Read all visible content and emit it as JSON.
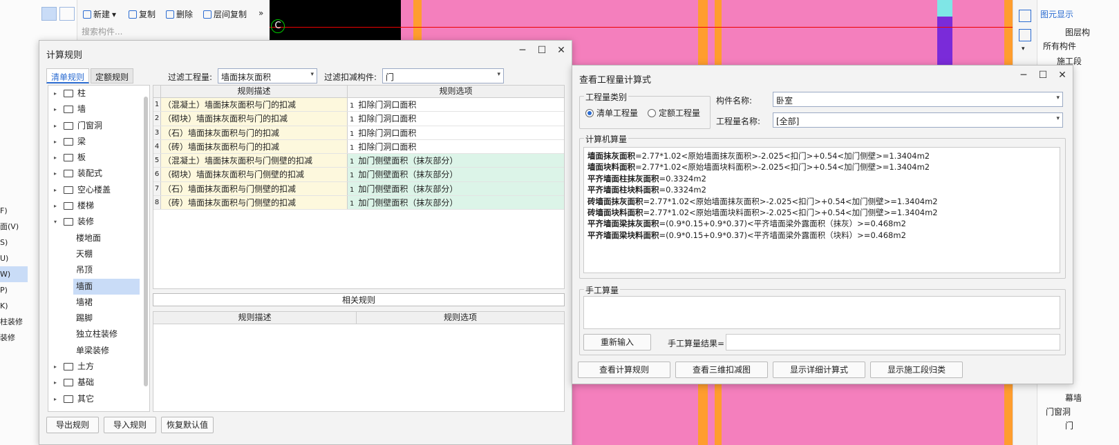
{
  "background": {
    "toolbar": {
      "new": "新建",
      "copy": "复制",
      "delete": "删除",
      "floor_copy": "层间复制"
    },
    "search_placeholder": "搜索构件...",
    "left_list": [
      "F)",
      "面(V)",
      "S)",
      "U)",
      "W)",
      "P)",
      "K)",
      "柱装修",
      "装修"
    ],
    "left_list_selected": 4,
    "right_panel": {
      "tab": "图元显示",
      "layers": "图层构",
      "all": "所有构件",
      "section": "施工段",
      "curtain": "幕墙",
      "door_window": "门窗洞",
      "door": "门"
    },
    "canvas_colors": {
      "pink": "#f47fbd",
      "orange": "#ff9d2e",
      "black": "#000000"
    }
  },
  "dialog1": {
    "title": "计算规则",
    "tabs": [
      "清单规则",
      "定额规则"
    ],
    "filter_qty_label": "过滤工程量:",
    "filter_qty_value": "墙面抹灰面积",
    "filter_deduct_label": "过滤扣减构件:",
    "filter_deduct_value": "门",
    "tree": [
      {
        "label": "柱",
        "level": 0,
        "expanded": false
      },
      {
        "label": "墙",
        "level": 0,
        "expanded": false
      },
      {
        "label": "门窗洞",
        "level": 0,
        "expanded": false
      },
      {
        "label": "梁",
        "level": 0,
        "expanded": false
      },
      {
        "label": "板",
        "level": 0,
        "expanded": false
      },
      {
        "label": "装配式",
        "level": 0,
        "expanded": false
      },
      {
        "label": "空心楼盖",
        "level": 0,
        "expanded": false
      },
      {
        "label": "楼梯",
        "level": 0,
        "expanded": false
      },
      {
        "label": "装修",
        "level": 0,
        "expanded": true
      },
      {
        "label": "楼地面",
        "level": 1
      },
      {
        "label": "天棚",
        "level": 1
      },
      {
        "label": "吊顶",
        "level": 1
      },
      {
        "label": "墙面",
        "level": 1,
        "selected": true
      },
      {
        "label": "墙裙",
        "level": 1
      },
      {
        "label": "踢脚",
        "level": 1
      },
      {
        "label": "独立柱装修",
        "level": 1
      },
      {
        "label": "单梁装修",
        "level": 1
      },
      {
        "label": "土方",
        "level": 0,
        "expanded": false
      },
      {
        "label": "基础",
        "level": 0,
        "expanded": false
      },
      {
        "label": "其它",
        "level": 0,
        "expanded": false
      }
    ],
    "grid_headers": [
      "规则描述",
      "规则选项"
    ],
    "rules": [
      {
        "n": "1",
        "desc": "（混凝土）墙面抹灰面积与门的扣减",
        "opt_n": "1",
        "opt": "扣除门洞口面积",
        "green": false
      },
      {
        "n": "2",
        "desc": "（砌块）墙面抹灰面积与门的扣减",
        "opt_n": "1",
        "opt": "扣除门洞口面积",
        "green": false
      },
      {
        "n": "3",
        "desc": "（石）墙面抹灰面积与门的扣减",
        "opt_n": "1",
        "opt": "扣除门洞口面积",
        "green": false
      },
      {
        "n": "4",
        "desc": "（砖）墙面抹灰面积与门的扣减",
        "opt_n": "1",
        "opt": "扣除门洞口面积",
        "green": false
      },
      {
        "n": "5",
        "desc": "（混凝土）墙面抹灰面积与门侧壁的扣减",
        "opt_n": "1",
        "opt": "加门侧壁面积（抹灰部分）",
        "green": true
      },
      {
        "n": "6",
        "desc": "（砌块）墙面抹灰面积与门侧壁的扣减",
        "opt_n": "1",
        "opt": "加门侧壁面积（抹灰部分）",
        "green": true
      },
      {
        "n": "7",
        "desc": "（石）墙面抹灰面积与门侧壁的扣减",
        "opt_n": "1",
        "opt": "加门侧壁面积（抹灰部分）",
        "green": true
      },
      {
        "n": "8",
        "desc": "（砖）墙面抹灰面积与门侧壁的扣减",
        "opt_n": "1",
        "opt": "加门侧壁面积（抹灰部分）",
        "green": true
      }
    ],
    "related_label": "相关规则",
    "related_headers": [
      "规则描述",
      "规则选项"
    ],
    "buttons": {
      "export": "导出规则",
      "import": "导入规则",
      "reset": "恢复默认值"
    }
  },
  "dialog2": {
    "title": "查看工程量计算式",
    "qty_type_label": "工程量类别",
    "radio_list": "清单工程量",
    "radio_quota": "定额工程量",
    "component_name_label": "构件名称:",
    "component_name_value": "卧室",
    "qty_name_label": "工程量名称:",
    "qty_name_value": "[全部]",
    "calc_label": "计算机算量",
    "calc_lines": [
      {
        "k": "墙面抹灰面积",
        "v": "=2.77*1.02<原始墙面抹灰面积>-2.025<扣门>+0.54<加门侧壁>=1.3404m2"
      },
      {
        "k": "墙面块料面积",
        "v": "=2.77*1.02<原始墙面块料面积>-2.025<扣门>+0.54<加门侧壁>=1.3404m2"
      },
      {
        "k": "平齐墙面柱抹灰面积",
        "v": "=0.3324m2"
      },
      {
        "k": "平齐墙面柱块料面积",
        "v": "=0.3324m2"
      },
      {
        "k": "砖墙面抹灰面积",
        "v": "=2.77*1.02<原始墙面抹灰面积>-2.025<扣门>+0.54<加门侧壁>=1.3404m2"
      },
      {
        "k": "砖墙面块料面积",
        "v": "=2.77*1.02<原始墙面块料面积>-2.025<扣门>+0.54<加门侧壁>=1.3404m2"
      },
      {
        "k": "平齐墙面梁抹灰面积",
        "v": "=(0.9*0.15+0.9*0.37)<平齐墙面梁外露面积（抹灰）>=0.468m2"
      },
      {
        "k": "平齐墙面梁块料面积",
        "v": "=(0.9*0.15+0.9*0.37)<平齐墙面梁外露面积（块料）>=0.468m2"
      }
    ],
    "manual_label": "手工算量",
    "reenter": "重新输入",
    "manual_result_label": "手工算量结果=",
    "buttons": {
      "view_rules": "查看计算规则",
      "view_3d": "查看三维扣减图",
      "show_detail": "显示详细计算式",
      "show_section": "显示施工段归类"
    }
  }
}
